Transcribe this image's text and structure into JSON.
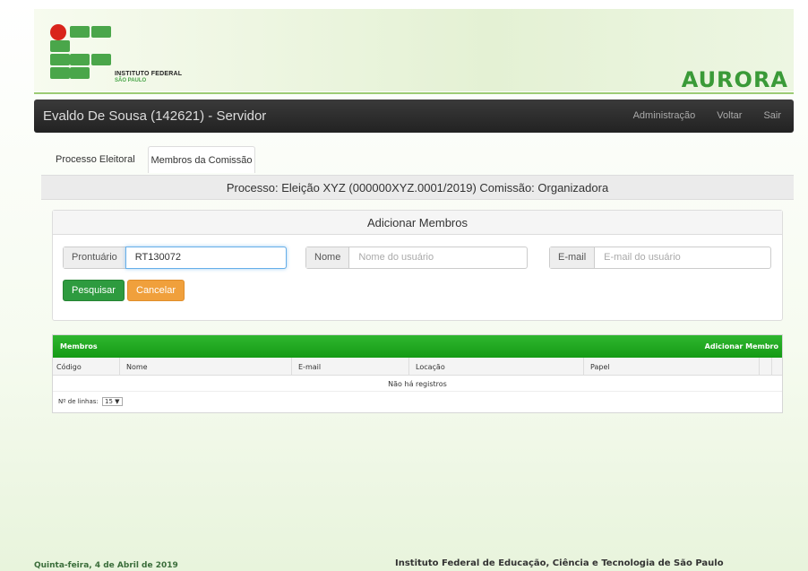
{
  "header": {
    "institution_line1": "INSTITUTO FEDERAL",
    "institution_line2": "SÃO PAULO",
    "system_logo_text": "AURORA"
  },
  "navbar": {
    "user": "Evaldo De Sousa (142621) - Servidor",
    "links": [
      "Administração",
      "Voltar",
      "Sair"
    ]
  },
  "tabs": [
    "Processo Eleitoral",
    "Membros da Comissão"
  ],
  "process_info": "Processo: Eleição XYZ (000000XYZ.0001/2019) Comissão: Organizadora",
  "add_panel": {
    "title": "Adicionar Membros",
    "prontuario": {
      "label": "Prontuário",
      "value": "RT130072"
    },
    "nome": {
      "label": "Nome",
      "placeholder": "Nome do usuário"
    },
    "email": {
      "label": "E-mail",
      "placeholder": "E-mail do usuário"
    },
    "search_button": "Pesquisar",
    "cancel_button": "Cancelar"
  },
  "members": {
    "title": "Membros",
    "add_link": "Adicionar Membro",
    "columns": [
      "Código",
      "Nome",
      "E-mail",
      "Locação",
      "Papel"
    ],
    "empty_message": "Não há registros",
    "rows_label": "Nº de linhas:",
    "rows_value": "15"
  },
  "footer": {
    "date": "Quinta-feira, 4 de Abril de 2019",
    "institution": "Instituto Federal de Educação, Ciência e Tecnologia de São Paulo"
  },
  "colors": {
    "green": "#2e9b3f",
    "orange": "#f0a03c",
    "navbar": "#2b2b2b"
  }
}
